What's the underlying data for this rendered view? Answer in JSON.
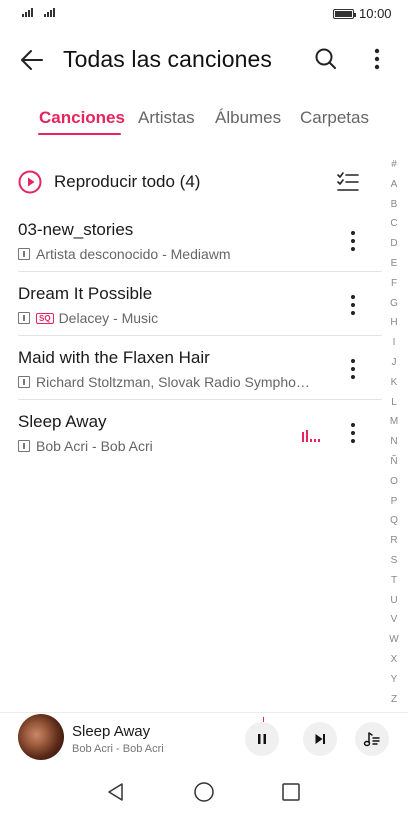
{
  "status_bar": {
    "time": "10:00"
  },
  "header": {
    "title": "Todas las canciones"
  },
  "tabs": [
    {
      "label": "Canciones",
      "active": true
    },
    {
      "label": "Artistas",
      "active": false
    },
    {
      "label": "Álbumes",
      "active": false
    },
    {
      "label": "Carpetas",
      "active": false
    }
  ],
  "play_all": {
    "label": "Reproducir todo (4)"
  },
  "songs": [
    {
      "title": "03-new_stories",
      "subtitle": "Artista desconocido - Mediawm",
      "sq": false,
      "playing": false
    },
    {
      "title": "Dream It Possible",
      "subtitle": "Delacey - Music",
      "sq": true,
      "sq_label": "SQ",
      "playing": false
    },
    {
      "title": "Maid with the Flaxen Hair",
      "subtitle": "Richard Stoltzman, Slovak Radio Sympho…",
      "sq": false,
      "playing": false
    },
    {
      "title": "Sleep Away",
      "subtitle": "Bob Acri - Bob Acri",
      "sq": false,
      "playing": true
    }
  ],
  "alphabet_index": [
    "#",
    "A",
    "B",
    "C",
    "D",
    "E",
    "F",
    "G",
    "H",
    "I",
    "J",
    "K",
    "L",
    "M",
    "N",
    "Ñ",
    "O",
    "P",
    "Q",
    "R",
    "S",
    "T",
    "U",
    "V",
    "W",
    "X",
    "Y",
    "Z"
  ],
  "now_playing": {
    "title": "Sleep Away",
    "artist": "Bob Acri - Bob Acri"
  },
  "colors": {
    "accent": "#e6245e",
    "text_primary": "#1a1a1a",
    "text_secondary": "#666666"
  }
}
